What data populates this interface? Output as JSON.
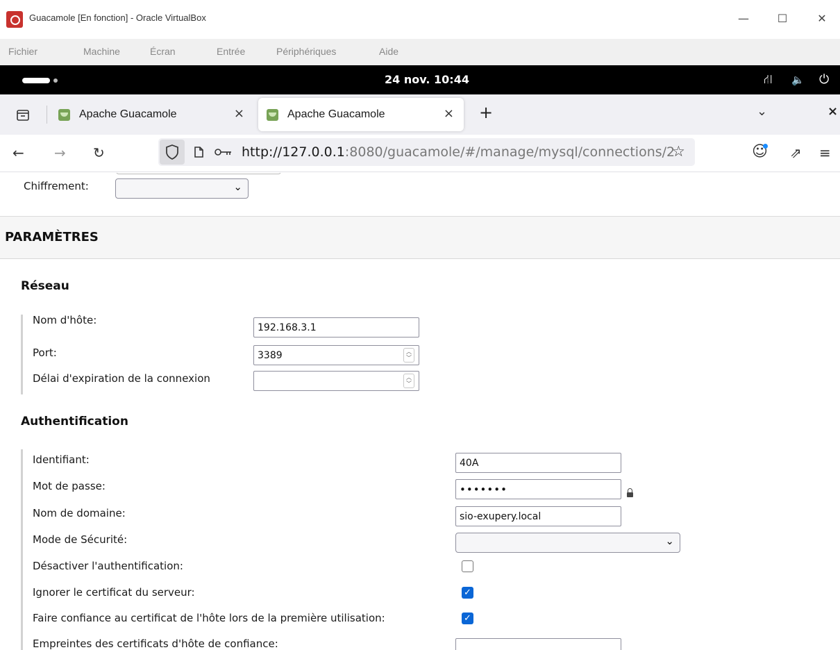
{
  "window": {
    "title": "Guacamole [En fonction] - Oracle VirtualBox",
    "minimize": "—",
    "maximize": "☐",
    "close": "✕"
  },
  "vbox_menu": [
    "Fichier",
    "Machine",
    "Écran",
    "Entrée",
    "Périphériques",
    "Aide"
  ],
  "gnome": {
    "clock": "24 nov. 10:44",
    "network_icon": "⛙",
    "volume_icon": "🔈",
    "power_icon": "⏻"
  },
  "tabs": [
    {
      "label": "Apache Guacamole",
      "close": "×"
    },
    {
      "label": "Apache Guacamole",
      "close": "×"
    }
  ],
  "tabstrip": {
    "new_tab": "+",
    "list_tabs": "⌄",
    "close": "×"
  },
  "nav": {
    "back": "←",
    "forward": "→",
    "reload": "↻",
    "url_host": "http://127.0.0.1",
    "url_rest": ":8080/guacamole/#/manage/mysql/connections/2",
    "bookmark": "☆",
    "account": "☺",
    "extensions": "⇗",
    "menu": "≡"
  },
  "form": {
    "chiffrement_label": "Chiffrement:",
    "section_title": "PARAMÈTRES",
    "network": {
      "title": "Réseau",
      "hostname_label": "Nom d'hôte:",
      "hostname_value": "192.168.3.1",
      "port_label": "Port:",
      "port_value": "3389",
      "timeout_label": "Délai d'expiration de la connexion",
      "timeout_value": ""
    },
    "auth": {
      "title": "Authentification",
      "username_label": "Identifiant:",
      "username_value": "40A",
      "password_label": "Mot de passe:",
      "password_value": "•••••••",
      "domain_label": "Nom de domaine:",
      "domain_value": "sio-exupery.local",
      "security_label": "Mode de Sécurité:",
      "disable_auth_label": "Désactiver l'authentification:",
      "disable_auth_checked": false,
      "ignore_cert_label": "Ignorer le certificat du serveur:",
      "ignore_cert_checked": true,
      "trust_first_label": "Faire confiance au certificat de l'hôte lors de la première utilisation:",
      "trust_first_checked": true,
      "fingerprints_label": "Empreintes des certificats d'hôte de confiance:",
      "fingerprints_value": ""
    }
  },
  "colors": {
    "checkbox_on": "#0a66d6",
    "section_bg": "#f6f6f6",
    "gnome_bar": "#000000"
  }
}
